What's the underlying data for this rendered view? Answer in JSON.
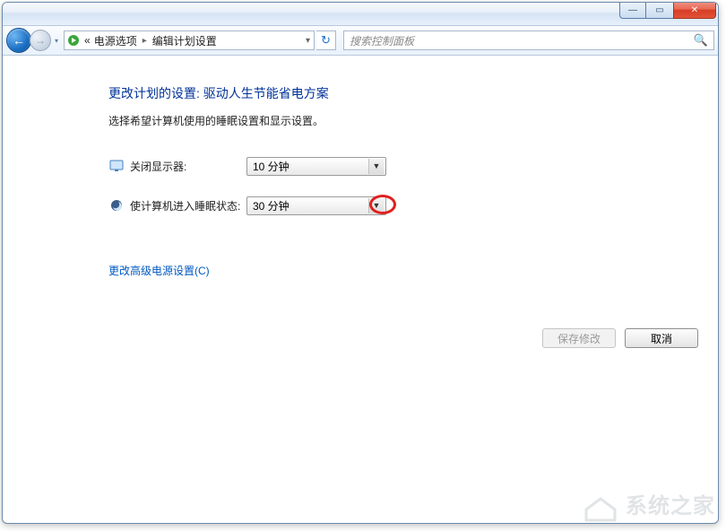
{
  "titlebar": {
    "minimize": "—",
    "maximize": "▭",
    "close": "✕"
  },
  "navbar": {
    "back_arrow": "←",
    "forward_arrow": "→",
    "history_dd": "▾",
    "breadcrumb_prefix": "«",
    "breadcrumb_item1": "电源选项",
    "breadcrumb_sep": "▸",
    "breadcrumb_item2": "编辑计划设置",
    "breadcrumb_dd": "▾",
    "refresh": "↻",
    "search_placeholder": "搜索控制面板",
    "search_icon": "🔍"
  },
  "content": {
    "heading": "更改计划的设置: 驱动人生节能省电方案",
    "subtext": "选择希望计算机使用的睡眠设置和显示设置。",
    "rows": [
      {
        "label": "关闭显示器:",
        "value": "10 分钟",
        "highlighted": false
      },
      {
        "label": "使计算机进入睡眠状态:",
        "value": "30 分钟",
        "highlighted": true
      }
    ],
    "advanced_link": "更改高级电源设置(C)",
    "save_button": "保存修改",
    "cancel_button": "取消"
  },
  "watermark": "系统之家"
}
